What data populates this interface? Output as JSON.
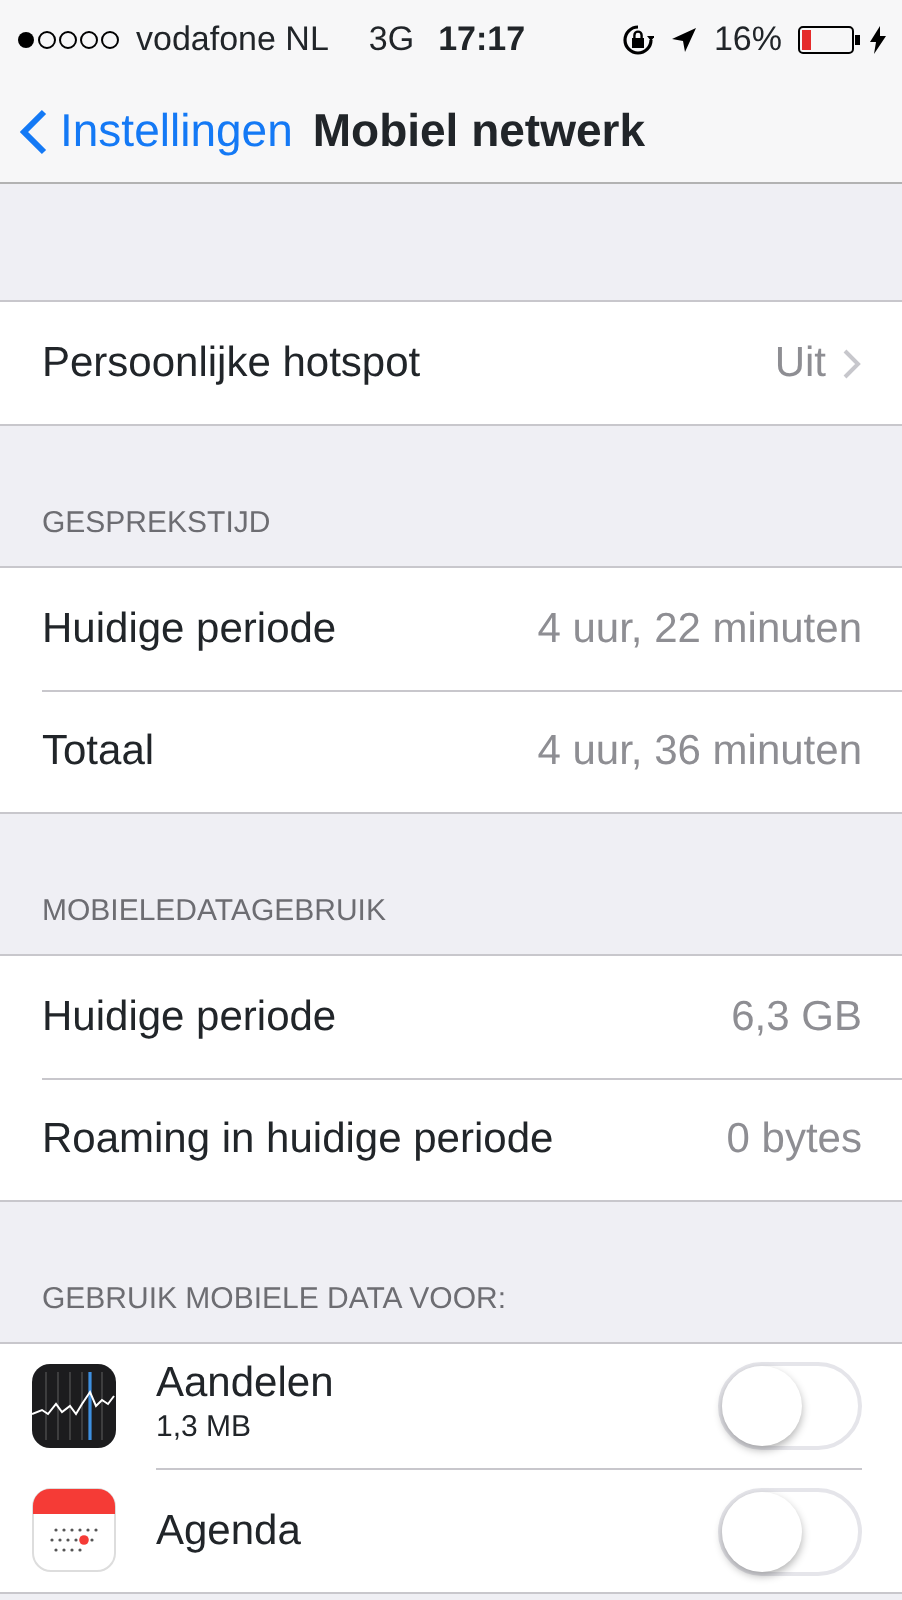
{
  "status_bar": {
    "carrier": "vodafone NL",
    "network": "3G",
    "time": "17:17",
    "battery": "16%"
  },
  "nav": {
    "back": "Instellingen",
    "title": "Mobiel netwerk"
  },
  "sections": [
    {
      "rows": [
        {
          "label": "Persoonlijke hotspot",
          "value": "Uit",
          "chevron": true
        }
      ]
    },
    {
      "header": "GESPREKSTIJD",
      "rows": [
        {
          "label": "Huidige periode",
          "value": "4 uur, 22 minuten",
          "chevron": false
        },
        {
          "label": "Totaal",
          "value": "4 uur, 36 minuten",
          "chevron": false
        }
      ]
    },
    {
      "header": "MOBIELEDATAGEBRUIK",
      "rows": [
        {
          "label": "Huidige periode",
          "value": "6,3 GB",
          "chevron": false
        },
        {
          "label": "Roaming in huidige periode",
          "value": "0 bytes",
          "chevron": false
        }
      ]
    }
  ],
  "apps_header": "GEBRUIK MOBIELE DATA VOOR:",
  "apps": [
    {
      "kind": "stocks",
      "name": "Aandelen",
      "usage": "1,3 MB",
      "on": false
    },
    {
      "kind": "calendar",
      "name": "Agenda",
      "on": false
    }
  ]
}
